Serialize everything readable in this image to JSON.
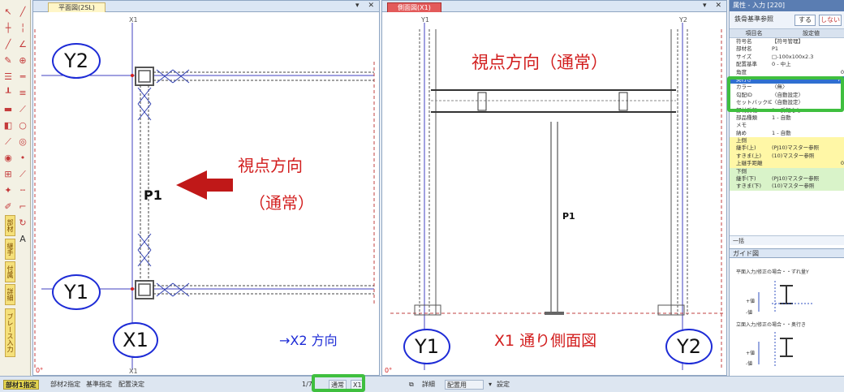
{
  "plan_pane": {
    "tab": "平面図(2SL)",
    "controls": [
      "▾",
      "✕"
    ],
    "grid_top": "X1",
    "grid_bottom": "X1",
    "member_label": "P1",
    "axis_Y2": "Y2",
    "axis_Y1": "Y1",
    "axis_X1": "X1",
    "view_dir_label_1": "視点方向",
    "view_dir_label_2": "（通常）",
    "direction_note": "→X2 方向",
    "origin": "0°"
  },
  "side_pane": {
    "tab": "側面図(X1)",
    "controls": [
      "▾",
      "✕"
    ],
    "grid_Y1_top": "Y1",
    "grid_Y2_top": "Y2",
    "member_label": "P1",
    "view_dir_label": "視点方向（通常）",
    "caption": "X1 通り側面図",
    "axis_Y1": "Y1",
    "axis_Y2": "Y2",
    "origin": "0°"
  },
  "property_panel": {
    "title": "属性 - 入力 [220]",
    "ref_label": "鉄骨基準参照",
    "btn_do": "する",
    "btn_dont": "しない",
    "header_name": "項目名",
    "header_value": "設定値",
    "rows": [
      {
        "k": "符号名",
        "v": "【符号管理】",
        "style": ""
      },
      {
        "k": "部材名",
        "v": "P1",
        "style": ""
      },
      {
        "k": "サイズ",
        "v": "□-100x100x2.3",
        "style": ""
      },
      {
        "k": "配置基準",
        "v": "0 - 中上",
        "style": ""
      },
      {
        "k": "角度",
        "v": "0",
        "style": ""
      },
      {
        "k": "奥行き",
        "v": "75",
        "style": "sel"
      },
      {
        "k": "カラー",
        "v": "〈無〉",
        "style": ""
      },
      {
        "k": "勾配ID",
        "v": "〈自動設定〉",
        "style": ""
      },
      {
        "k": "セットバックID",
        "v": "〈自動設定〉",
        "style": ""
      },
      {
        "k": "部材反転",
        "v": "1 - 反転なし",
        "style": ""
      },
      {
        "k": "部品種類",
        "v": "1 - 自動",
        "style": ""
      },
      {
        "k": "メモ",
        "v": "",
        "style": ""
      },
      {
        "k": "納め",
        "v": "1 - 自動",
        "style": ""
      },
      {
        "k": "上側",
        "v": "",
        "style": "yel"
      },
      {
        "k": "継手(上)",
        "v": "(PJ10)マスター参照",
        "style": "yel"
      },
      {
        "k": "すきま(上)",
        "v": "(10)マスター参照",
        "style": "yel"
      },
      {
        "k": "上継手距離",
        "v": "0",
        "style": "yel"
      },
      {
        "k": "下側",
        "v": "",
        "style": "grn"
      },
      {
        "k": "継手(下)",
        "v": "(PJ10)マスター参照",
        "style": "grn"
      },
      {
        "k": "すきま(下)",
        "v": "(10)マスター参照",
        "style": "grn"
      }
    ],
    "footer": "一括",
    "guide_title": "ガイド図",
    "guide_text_1": "平面入力/修正の場合・・ずれ量Y",
    "guide_text_2": "立面入力/修正の場合・・奥行き",
    "guide_plus": "+値",
    "guide_minus": "-値"
  },
  "status_bar": {
    "tabs": [
      "部材1指定",
      "部材2指定",
      "基準指定",
      "配置決定"
    ],
    "page": "1/7",
    "mode": "通常",
    "grid": "X1",
    "detail": "詳細",
    "layout": "配置用",
    "settings": "設定"
  },
  "colors": {
    "accent_red": "#d21e1e",
    "circle_blue": "#1d2bd6",
    "highlight_green": "#3fbf3f"
  }
}
